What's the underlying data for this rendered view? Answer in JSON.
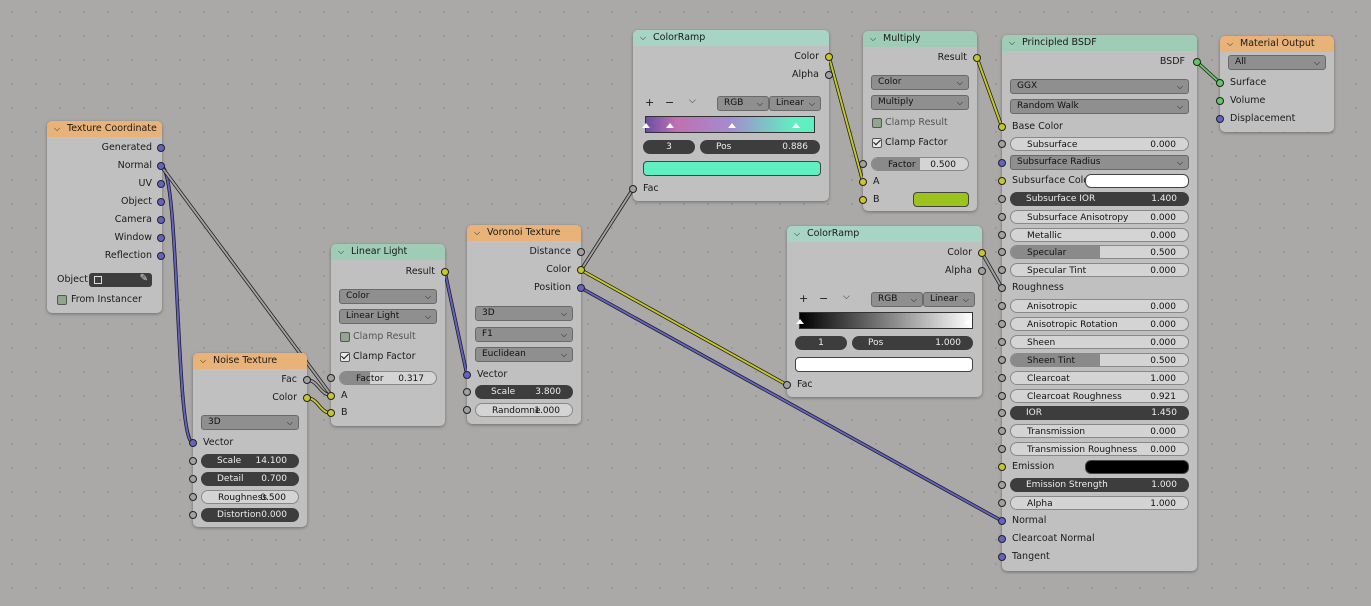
{
  "nodes": {
    "texture_coordinate": {
      "title": "Texture Coordinate",
      "outputs": [
        "Generated",
        "Normal",
        "UV",
        "Object",
        "Camera",
        "Window",
        "Reflection"
      ],
      "object_label": "Object:",
      "from_instancer": "From Instancer"
    },
    "noise_texture": {
      "title": "Noise Texture",
      "outputs": [
        "Fac",
        "Color"
      ],
      "dimensions": "3D",
      "vector_label": "Vector",
      "fields": [
        {
          "label": "Scale",
          "value": "14.100"
        },
        {
          "label": "Detail",
          "value": "0.700"
        },
        {
          "label": "Roughness",
          "value": "0.500"
        },
        {
          "label": "Distortion",
          "value": "0.000"
        }
      ]
    },
    "linear_light": {
      "title": "Linear Light",
      "output": "Result",
      "type": "Color",
      "blend": "Linear Light",
      "clamp_result": "Clamp Result",
      "clamp_factor": "Clamp Factor",
      "factor_label": "Factor",
      "factor_value": "0.317",
      "input_a": "A",
      "input_b": "B"
    },
    "voronoi": {
      "title": "Voronoi Texture",
      "outputs": [
        "Distance",
        "Color",
        "Position"
      ],
      "dimensions": "3D",
      "feature": "F1",
      "metric": "Euclidean",
      "vector_label": "Vector",
      "scale_label": "Scale",
      "scale_value": "3.800",
      "randomness_label": "Randomne",
      "randomness_value": "1.000"
    },
    "colorramp1": {
      "title": "ColorRamp",
      "outputs": [
        "Color",
        "Alpha"
      ],
      "color_mode": "RGB",
      "interpolation": "Linear",
      "index": "3",
      "pos_label": "Pos",
      "pos_value": "0.886",
      "fac_label": "Fac",
      "swatch_color": "#60efc0"
    },
    "multiply": {
      "title": "Multiply",
      "output": "Result",
      "type": "Color",
      "blend": "Multiply",
      "clamp_result": "Clamp Result",
      "clamp_factor": "Clamp Factor",
      "factor_label": "Factor",
      "factor_value": "0.500",
      "input_a": "A",
      "input_b": "B",
      "b_color": "#9bc21d"
    },
    "colorramp2": {
      "title": "ColorRamp",
      "outputs": [
        "Color",
        "Alpha"
      ],
      "color_mode": "RGB",
      "interpolation": "Linear",
      "index": "1",
      "pos_label": "Pos",
      "pos_value": "1.000",
      "fac_label": "Fac",
      "swatch_color": "#ffffff"
    },
    "principled": {
      "title": "Principled BSDF",
      "output": "BSDF",
      "distribution": "GGX",
      "subsurface_method": "Random Walk",
      "base_color": "Base Color",
      "subsurface": {
        "label": "Subsurface",
        "value": "0.000"
      },
      "subsurface_radius": "Subsurface Radius",
      "subsurface_color": "Subsurface Color",
      "fields": [
        {
          "label": "Subsurface IOR",
          "value": "1.400"
        },
        {
          "label": "Subsurface Anisotropy",
          "value": "0.000"
        },
        {
          "label": "Metallic",
          "value": "0.000"
        },
        {
          "label": "Specular",
          "value": "0.500"
        },
        {
          "label": "Specular Tint",
          "value": "0.000"
        }
      ],
      "roughness": "Roughness",
      "fields2": [
        {
          "label": "Anisotropic",
          "value": "0.000"
        },
        {
          "label": "Anisotropic Rotation",
          "value": "0.000"
        },
        {
          "label": "Sheen",
          "value": "0.000"
        },
        {
          "label": "Sheen Tint",
          "value": "0.500"
        },
        {
          "label": "Clearcoat",
          "value": "1.000"
        },
        {
          "label": "Clearcoat Roughness",
          "value": "0.921"
        },
        {
          "label": "IOR",
          "value": "1.450"
        },
        {
          "label": "Transmission",
          "value": "0.000"
        },
        {
          "label": "Transmission Roughness",
          "value": "0.000"
        }
      ],
      "emission": "Emission",
      "emission_strength": {
        "label": "Emission Strength",
        "value": "1.000"
      },
      "alpha": {
        "label": "Alpha",
        "value": "1.000"
      },
      "normal": "Normal",
      "clearcoat_normal": "Clearcoat Normal",
      "tangent": "Tangent"
    },
    "material_output": {
      "title": "Material Output",
      "target": "All",
      "inputs": [
        "Surface",
        "Volume",
        "Displacement"
      ]
    }
  }
}
